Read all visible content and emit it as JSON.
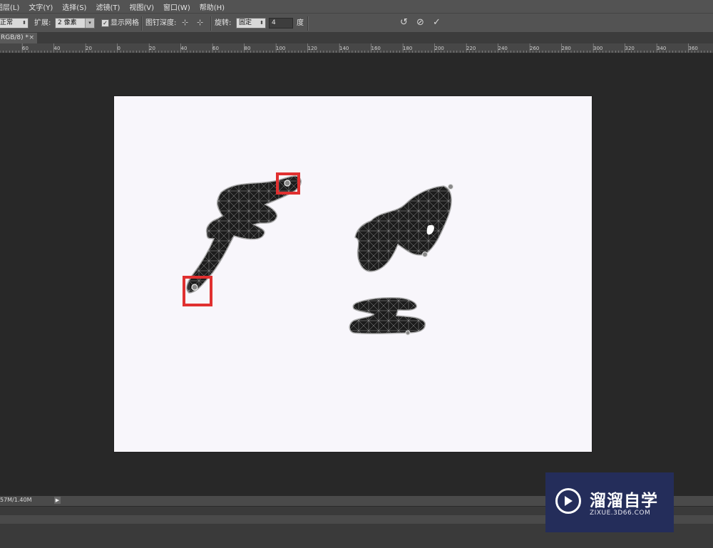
{
  "menu": {
    "items": [
      "图层(L)",
      "文字(Y)",
      "选择(S)",
      "滤镜(T)",
      "视图(V)",
      "窗口(W)",
      "帮助(H)"
    ]
  },
  "options": {
    "mode_value": "正常",
    "expand_label": "扩展:",
    "expand_value": "2 像素",
    "show_mesh_label": "显示网格",
    "show_mesh_checked": true,
    "pin_depth_label": "图钉深度:",
    "rotate_label": "旋转:",
    "rotate_value": "固定",
    "angle_value": "4",
    "degree_label": "度"
  },
  "document_tab": {
    "title": "RGB/8) *",
    "close": "×"
  },
  "ruler": {
    "labels": [
      "60",
      "40",
      "20",
      "0",
      "20",
      "40",
      "60",
      "80",
      "100",
      "120",
      "140",
      "160",
      "180",
      "200",
      "220",
      "240",
      "260",
      "280",
      "300",
      "320",
      "340",
      "360"
    ]
  },
  "status": {
    "doc_size": "57M/1.40M"
  },
  "watermark": {
    "title": "溜溜自学",
    "subtitle": "ZIXUE.3D66.COM"
  },
  "colors": {
    "highlight_box": "#e03030",
    "mesh_fill": "#1c1c1c",
    "canvas": "#f8f6fb"
  }
}
